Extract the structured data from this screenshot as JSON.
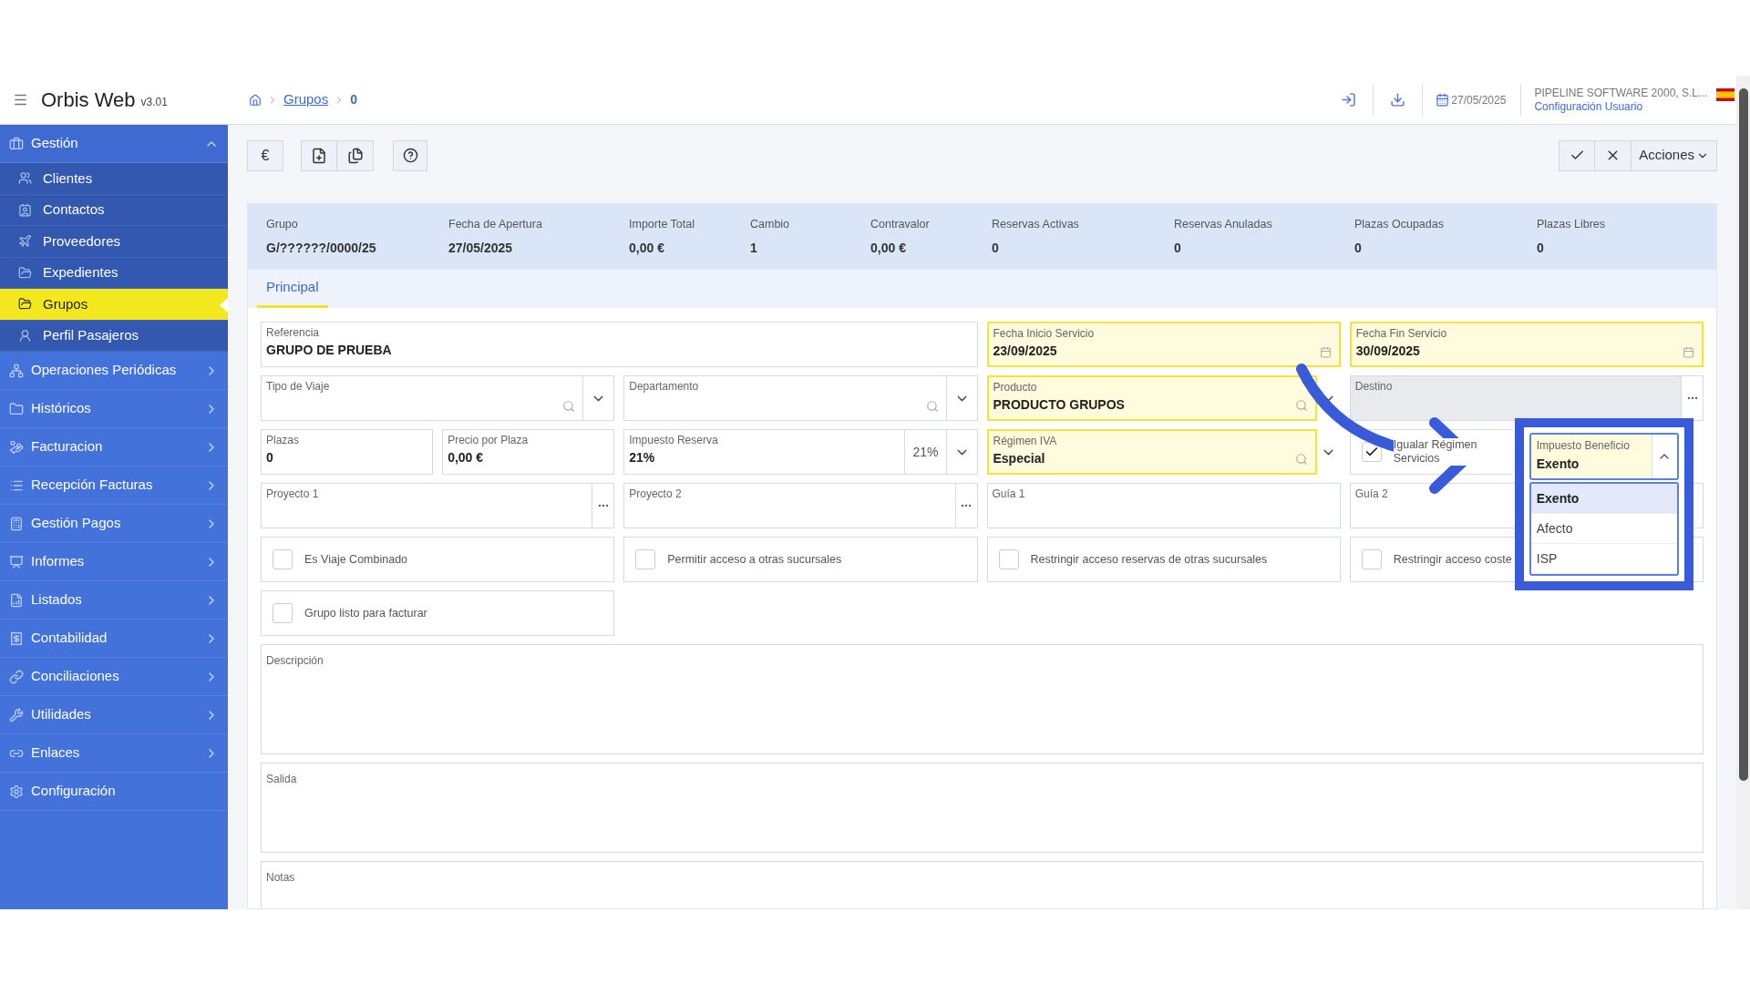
{
  "app": {
    "title": "Orbis Web",
    "version": "v3.01"
  },
  "breadcrumb": {
    "link": "Grupos",
    "current": "0"
  },
  "header": {
    "date": "27/05/2025",
    "company": "PIPELINE SOFTWARE 2000, S.L...",
    "user_link": "Configuración Usuario"
  },
  "sidebar": {
    "items": [
      {
        "label": "Gestión",
        "kind": "group",
        "expanded": true,
        "children": [
          {
            "label": "Clientes",
            "selected": false
          },
          {
            "label": "Contactos",
            "selected": false
          },
          {
            "label": "Proveedores",
            "selected": false
          },
          {
            "label": "Expedientes",
            "selected": false
          },
          {
            "label": "Grupos",
            "selected": true
          },
          {
            "label": "Perfil Pasajeros",
            "selected": false
          }
        ]
      },
      {
        "label": "Operaciones Periódicas",
        "kind": "group",
        "expanded": false
      },
      {
        "label": "Históricos",
        "kind": "group",
        "expanded": false
      },
      {
        "label": "Facturacion",
        "kind": "group",
        "expanded": false
      },
      {
        "label": "Recepción Facturas",
        "kind": "group",
        "expanded": false
      },
      {
        "label": "Gestión Pagos",
        "kind": "group",
        "expanded": false
      },
      {
        "label": "Informes",
        "kind": "group",
        "expanded": false
      },
      {
        "label": "Listados",
        "kind": "group",
        "expanded": false
      },
      {
        "label": "Contabilidad",
        "kind": "group",
        "expanded": false
      },
      {
        "label": "Conciliaciones",
        "kind": "group",
        "expanded": false
      },
      {
        "label": "Utilidades",
        "kind": "group",
        "expanded": false
      },
      {
        "label": "Enlaces",
        "kind": "group",
        "expanded": false
      },
      {
        "label": "Configuración",
        "kind": "link"
      }
    ]
  },
  "toolbar": {
    "currency_label": "€",
    "actions_label": "Acciones"
  },
  "summary": [
    {
      "label": "Grupo",
      "value": "G/??????/0000/25"
    },
    {
      "label": "Fecha de Apertura",
      "value": "27/05/2025"
    },
    {
      "label": "Importe Total",
      "value": "0,00 €"
    },
    {
      "label": "Cambio",
      "value": "1"
    },
    {
      "label": "Contravalor",
      "value": "0,00 €"
    },
    {
      "label": "Reservas Activas",
      "value": "0"
    },
    {
      "label": "Reservas Anuladas",
      "value": "0"
    },
    {
      "label": "Plazas Ocupadas",
      "value": "0"
    },
    {
      "label": "Plazas Libres",
      "value": "0"
    }
  ],
  "tabs": [
    {
      "label": "Principal",
      "selected": true
    }
  ],
  "form": {
    "rows": [
      [
        {
          "kind": "text",
          "label": "Referencia",
          "value": "GRUPO DE PRUEBA",
          "highlighted": false,
          "disabled": false
        },
        "",
        {
          "kind": "date",
          "label": "Fecha Inicio Servicio",
          "value": "23/09/2025",
          "highlighted": true,
          "disabled": false
        },
        {
          "kind": "date",
          "label": "Fecha Fin Servicio",
          "value": "30/09/2025",
          "highlighted": true,
          "disabled": false
        }
      ],
      [
        {
          "kind": "search_select",
          "label": "Tipo de Viaje",
          "highlighted": false,
          "disabled": false
        },
        {
          "kind": "search_select",
          "label": "Departamento",
          "highlighted": false,
          "disabled": false
        },
        {
          "kind": "search_select",
          "label": "Producto",
          "value": "PRODUCTO GRUPOS",
          "highlighted": true,
          "disabled": false
        },
        {
          "kind": "lookup",
          "label": "Destino",
          "highlighted": false,
          "disabled": true
        }
      ],
      [
        {
          "kind": "pair",
          "fields": [
            {
              "kind": "text",
              "label": "Plazas",
              "value": "0",
              "highlighted": false,
              "disabled": false
            },
            {
              "kind": "text",
              "label": "Precio por Plaza",
              "value": "0,00 €",
              "highlighted": false,
              "disabled": false
            }
          ]
        },
        {
          "kind": "rate_select",
          "label": "Impuesto Reserva",
          "value": "21%",
          "unit": "21%",
          "highlighted": false,
          "disabled": false
        },
        {
          "kind": "search_select",
          "label": "Régimen IVA",
          "value": "Especial",
          "highlighted": true,
          "disabled": false
        },
        {
          "kind": "checkbox",
          "label": "Igualar Régimen Servicios",
          "checked": true
        }
      ],
      [
        {
          "kind": "lookup",
          "label": "Proyecto 1",
          "highlighted": false,
          "disabled": false
        },
        {
          "kind": "lookup",
          "label": "Proyecto 2",
          "highlighted": false,
          "disabled": false
        },
        {
          "kind": "text",
          "label": "Guía 1",
          "highlighted": false,
          "disabled": false
        },
        {
          "kind": "text",
          "label": "Guía 2",
          "highlighted": false,
          "disabled": false
        }
      ],
      [
        {
          "kind": "checkbox",
          "label": "Es Viaje Combinado",
          "checked": false
        },
        {
          "kind": "checkbox",
          "label": "Permitir acceso a otras sucursales",
          "checked": false
        },
        {
          "kind": "checkbox",
          "label": "Restringir acceso reservas de otras sucursales",
          "checked": false
        },
        {
          "kind": "checkbox",
          "label": "Restringir acceso coste",
          "checked": false
        }
      ],
      [
        {
          "kind": "checkbox",
          "label": "Grupo listo para facturar",
          "checked": false
        }
      ]
    ],
    "textareas": [
      {
        "label": "Descripción"
      },
      {
        "label": "Salida"
      },
      {
        "label": "Notas"
      }
    ]
  },
  "popup": {
    "label": "Impuesto Beneficio",
    "value": "Exento",
    "expanded": true,
    "highlighted": true,
    "options": [
      {
        "label": "Exento",
        "selected": true
      },
      {
        "label": "Afecto",
        "selected": false
      },
      {
        "label": "ISP",
        "selected": false
      }
    ]
  }
}
